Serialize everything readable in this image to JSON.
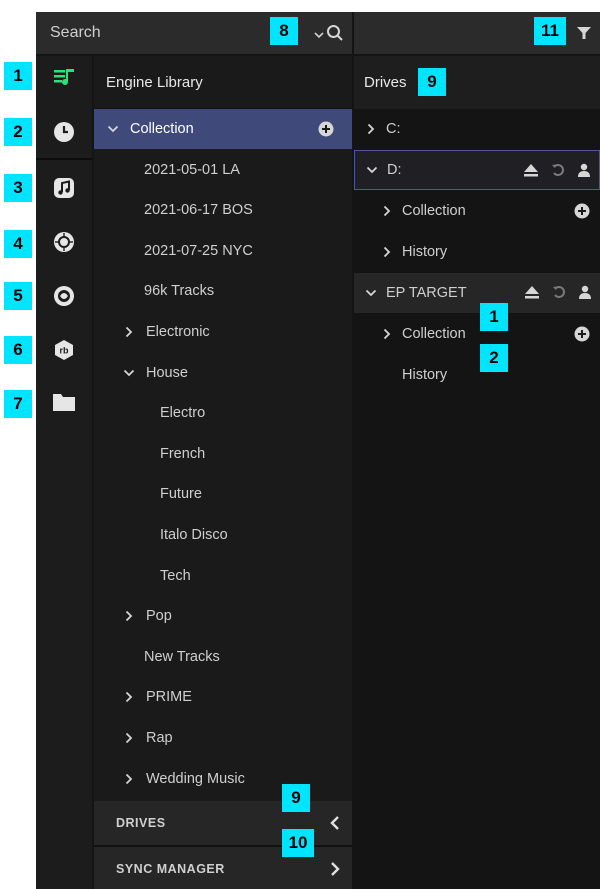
{
  "search": {
    "label": "Search"
  },
  "library": {
    "title": "Engine Library",
    "tree": [
      {
        "label": "Collection",
        "chevron": "down",
        "level": 0,
        "selected": true,
        "add": true
      },
      {
        "label": "2021-05-01 LA",
        "chevron": "none",
        "level": 1
      },
      {
        "label": "2021-06-17 BOS",
        "chevron": "none",
        "level": 1
      },
      {
        "label": "2021-07-25 NYC",
        "chevron": "none",
        "level": 1
      },
      {
        "label": "96k Tracks",
        "chevron": "none",
        "level": 1
      },
      {
        "label": "Electronic",
        "chevron": "right",
        "level": 1
      },
      {
        "label": "House",
        "chevron": "down",
        "level": 1
      },
      {
        "label": "Electro",
        "chevron": "none",
        "level": 2
      },
      {
        "label": "French",
        "chevron": "none",
        "level": 2
      },
      {
        "label": "Future",
        "chevron": "none",
        "level": 2
      },
      {
        "label": "Italo Disco",
        "chevron": "none",
        "level": 2
      },
      {
        "label": "Tech",
        "chevron": "none",
        "level": 2
      },
      {
        "label": "Pop",
        "chevron": "right",
        "level": 1
      },
      {
        "label": "New Tracks",
        "chevron": "none",
        "level": 1
      },
      {
        "label": "PRIME",
        "chevron": "right",
        "level": 1
      },
      {
        "label": "Rap",
        "chevron": "right",
        "level": 1
      },
      {
        "label": "Wedding Music",
        "chevron": "right",
        "level": 1
      }
    ],
    "drives_panel": "DRIVES",
    "sync_panel": "SYNC MANAGER"
  },
  "drives": {
    "title": "Drives",
    "rows": [
      {
        "label": "C:",
        "chevron": "right",
        "level": 0
      },
      {
        "label": "D:",
        "chevron": "down",
        "level": 0,
        "tools": true,
        "style": "boxed"
      },
      {
        "label": "Collection",
        "chevron": "right",
        "level": 1,
        "add": true
      },
      {
        "label": "History",
        "chevron": "right",
        "level": 1
      },
      {
        "label": "EP TARGET",
        "chevron": "down",
        "level": 0,
        "tools": true,
        "style": "shaded"
      },
      {
        "label": "Collection",
        "chevron": "right",
        "level": 1,
        "add": true
      },
      {
        "label": "History",
        "chevron": "none",
        "level": 1
      }
    ]
  },
  "rail_icons": [
    "playlist-icon",
    "history-clock-icon",
    "itunes-icon",
    "traktor-icon",
    "serato-icon",
    "rekordbox-icon",
    "folder-icon"
  ],
  "badges": {
    "b1": "1",
    "b2": "2",
    "b3": "3",
    "b4": "4",
    "b5": "5",
    "b6": "6",
    "b7": "7",
    "b8": "8",
    "b9a": "9",
    "b9b": "9",
    "b10": "10",
    "b11": "11",
    "d1": "1",
    "d2": "2"
  },
  "colors": {
    "accent_green": "#2fe07a",
    "selection": "#3f4a7b",
    "badge": "#00e5ff"
  }
}
